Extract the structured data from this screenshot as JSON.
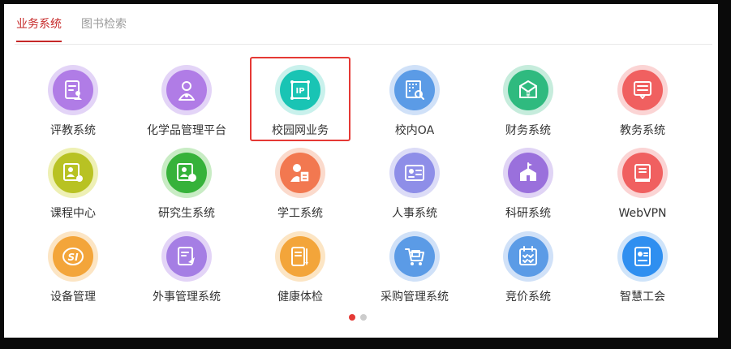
{
  "tabs": [
    {
      "label": "业务系统",
      "active": true
    },
    {
      "label": "图书检索",
      "active": false
    }
  ],
  "apps": [
    {
      "label": "评教系统",
      "icon": "evaluation-icon",
      "ring": "#e3d4f7",
      "color": "#b07ce6"
    },
    {
      "label": "化学品管理平台",
      "icon": "chemical-user-icon",
      "ring": "#e3d4f7",
      "color": "#b07ce6"
    },
    {
      "label": "校园网业务",
      "icon": "ip-network-icon",
      "ring": "#c9f1ec",
      "color": "#19c4b4",
      "highlighted": true
    },
    {
      "label": "校内OA",
      "icon": "oa-search-icon",
      "ring": "#d0e1f8",
      "color": "#5b9be6"
    },
    {
      "label": "财务系统",
      "icon": "finance-icon",
      "ring": "#c6ecdc",
      "color": "#2fba7f"
    },
    {
      "label": "教务系统",
      "icon": "academic-icon",
      "ring": "#fbd4d4",
      "color": "#f06060"
    },
    {
      "label": "课程中心",
      "icon": "course-icon",
      "ring": "#eef0b4",
      "color": "#b8c223"
    },
    {
      "label": "研究生系统",
      "icon": "graduate-icon",
      "ring": "#c8ecc4",
      "color": "#36b23a"
    },
    {
      "label": "学工系统",
      "icon": "student-affairs-icon",
      "ring": "#fbdacc",
      "color": "#f27850"
    },
    {
      "label": "人事系统",
      "icon": "personnel-icon",
      "ring": "#dcdcf7",
      "color": "#8e8ee8"
    },
    {
      "label": "科研系统",
      "icon": "research-icon",
      "ring": "#e0d4f5",
      "color": "#9a70dc"
    },
    {
      "label": "WebVPN",
      "icon": "webvpn-icon",
      "ring": "#fbd4d4",
      "color": "#f06060"
    },
    {
      "label": "设备管理",
      "icon": "equipment-icon",
      "ring": "#fce5c4",
      "color": "#f3a53a"
    },
    {
      "label": "外事管理系统",
      "icon": "foreign-affairs-icon",
      "ring": "#e3d4f7",
      "color": "#a57ee4"
    },
    {
      "label": "健康体检",
      "icon": "health-check-icon",
      "ring": "#fce5c4",
      "color": "#f3a53a"
    },
    {
      "label": "采购管理系统",
      "icon": "purchase-icon",
      "ring": "#d0e1f8",
      "color": "#5b9be6"
    },
    {
      "label": "竞价系统",
      "icon": "bidding-icon",
      "ring": "#d0e1f8",
      "color": "#5b9be6"
    },
    {
      "label": "智慧工会",
      "icon": "union-icon",
      "ring": "#cfe4fa",
      "color": "#2f8ff0"
    }
  ],
  "pagination": {
    "pages": 2,
    "current": 1,
    "active_color": "#e53935",
    "inactive_color": "#cccccc"
  }
}
